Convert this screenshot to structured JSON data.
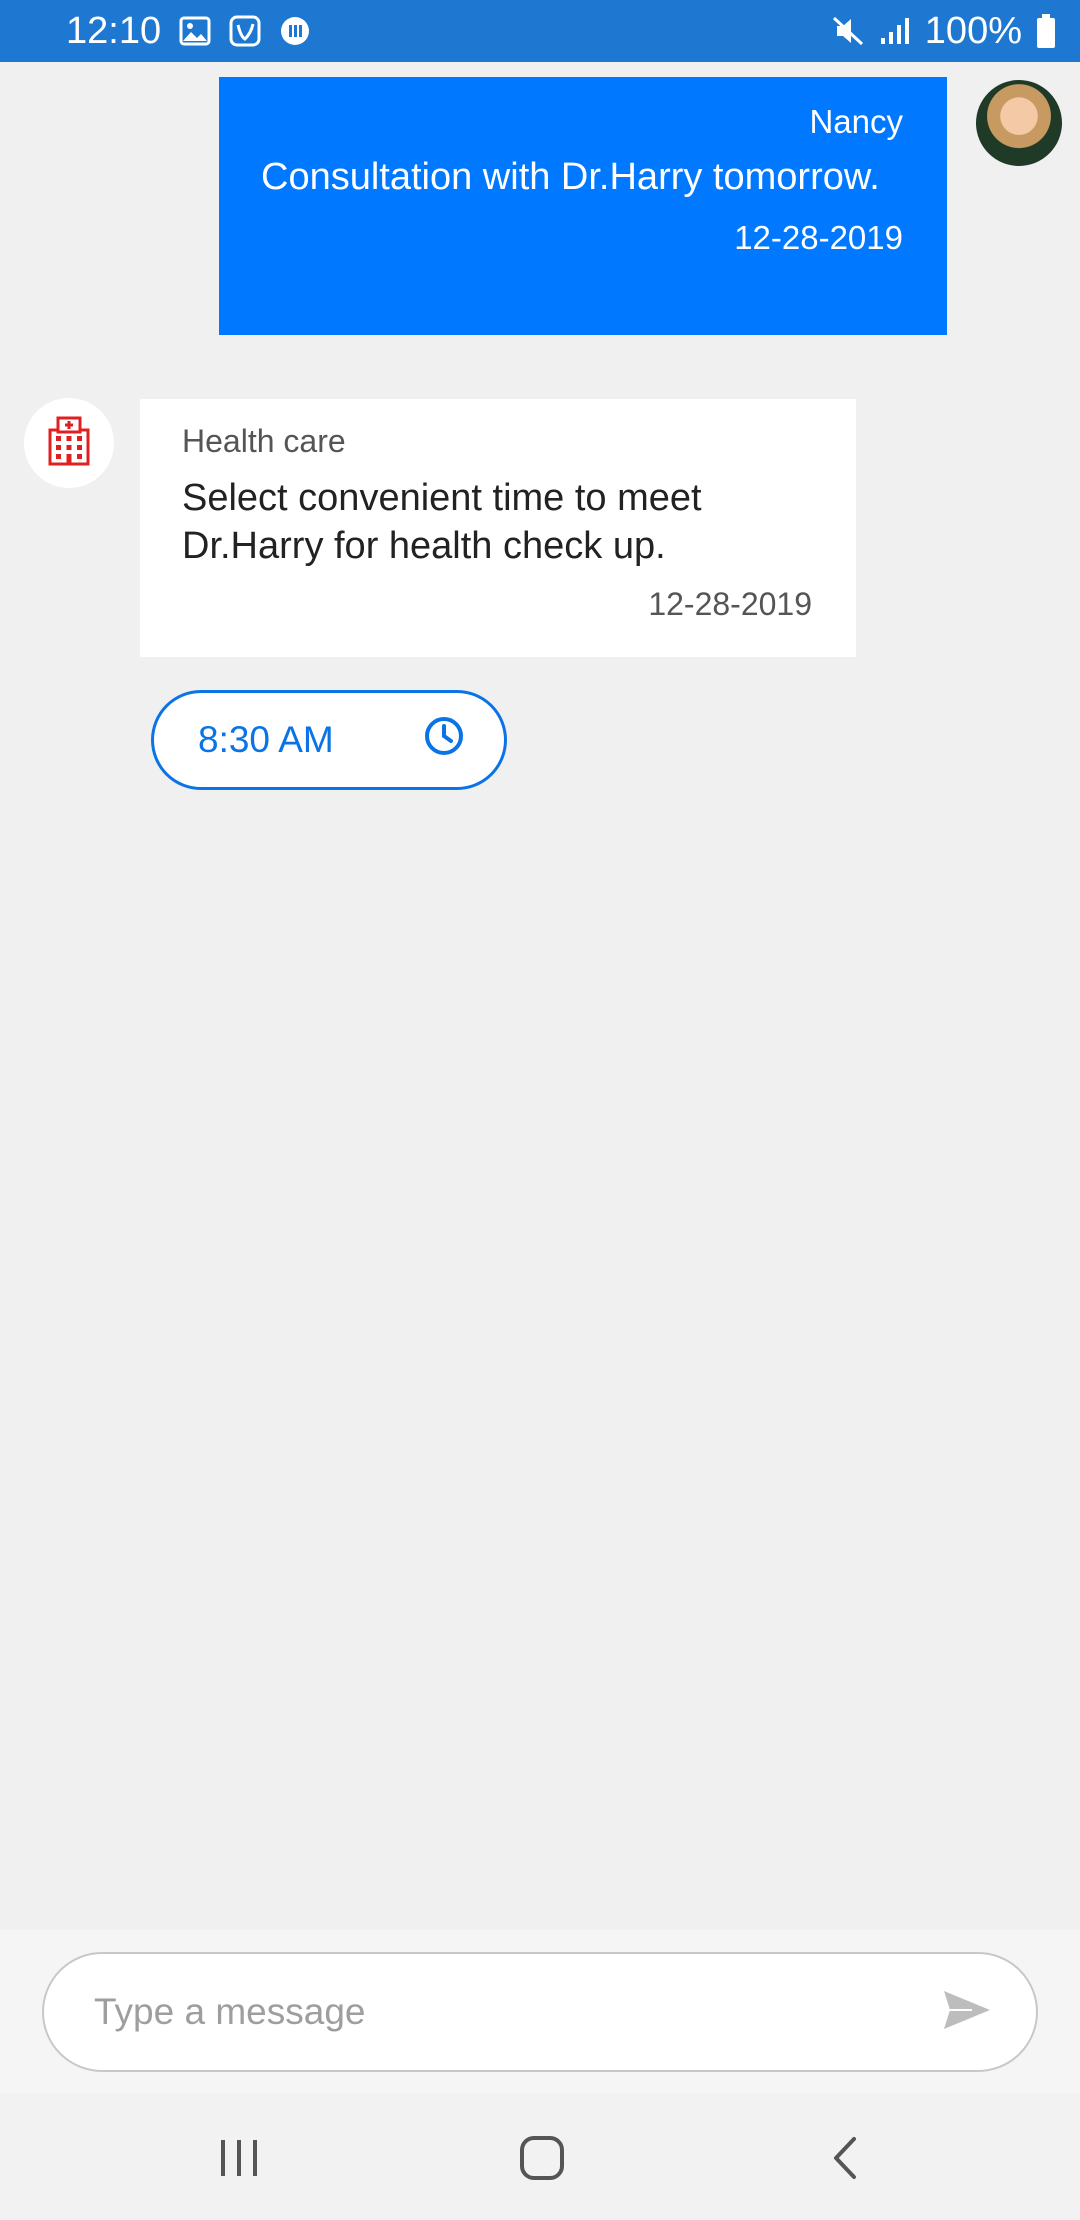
{
  "status_bar": {
    "time": "12:10",
    "battery": "100%",
    "icons": [
      "gallery-icon",
      "saavn-icon",
      "pause-circle-icon",
      "mute-icon",
      "signal-icon",
      "battery-icon"
    ]
  },
  "messages": [
    {
      "sender": "Nancy",
      "text": "Consultation with Dr.Harry tomorrow.",
      "date": "12-28-2019",
      "avatar": "nancy-avatar",
      "color": "#0078ff"
    },
    {
      "sender": "Health care",
      "text": "Select convenient time to meet Dr.Harry for health check up.",
      "date": "12-28-2019",
      "avatar": "hospital-icon",
      "icon_color": "#e02020"
    }
  ],
  "time_picker": {
    "value": "8:30 AM",
    "icon": "clock-icon",
    "color": "#0a74e6"
  },
  "composer": {
    "placeholder": "Type a message",
    "value": "",
    "send_icon": "send-icon"
  },
  "nav_bar": {
    "icons": [
      "recent-apps-icon",
      "home-icon",
      "back-icon"
    ]
  }
}
